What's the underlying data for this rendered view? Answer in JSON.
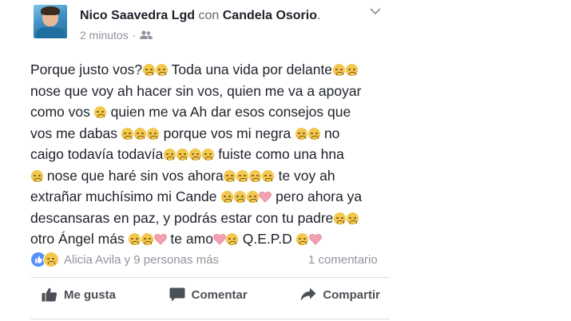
{
  "post": {
    "author": "Nico Saavedra Lgd",
    "connector": "con",
    "tagged": "Candela Osorio",
    "end_punct": ".",
    "time": "2 minutos",
    "separator": "·",
    "audience_icon": "friends-icon",
    "menu_icon": "chevron-down-icon",
    "body": {
      "l1a": "Porque justo vos?",
      "l1b": " Toda una vida por delante",
      "l2": "nose que voy ah hacer sin vos, quien me va a apoyar",
      "l3a": "como vos ",
      "l3b": " quien me va Ah dar esos consejos que",
      "l4a": "vos me dabas ",
      "l4b": " porque vos mi negra ",
      "l4c": " no",
      "l5a": "caigo todavía todavía",
      "l5b": " fuiste como una hna",
      "l6a": " nose que haré sin vos ahora",
      "l6b": " te voy ah",
      "l7a": "extrañar muchísimo mi Cande ",
      "l7b": " pero ahora ya",
      "l8": "descansaras en paz, y podrás estar con tu padre",
      "l9a": "otro Ángel más ",
      "l9b": " te amo",
      "l9c": " Q.E.P.D "
    }
  },
  "reactions": {
    "icons": [
      "like-reaction-icon",
      "sad-reaction-icon"
    ],
    "text": "Alicia Avila y 9 personas más",
    "comments": "1 comentario"
  },
  "actions": [
    {
      "label": "Me gusta",
      "icon": "thumbs-up-icon"
    },
    {
      "label": "Comentar",
      "icon": "comment-icon"
    },
    {
      "label": "Compartir",
      "icon": "share-icon"
    }
  ],
  "colors": {
    "text": "#1d2129",
    "meta": "#90949c",
    "like_blue": "#5890ff",
    "emoji_yellow": "#f3c84f",
    "heart_pink": "#f4a0b0"
  }
}
